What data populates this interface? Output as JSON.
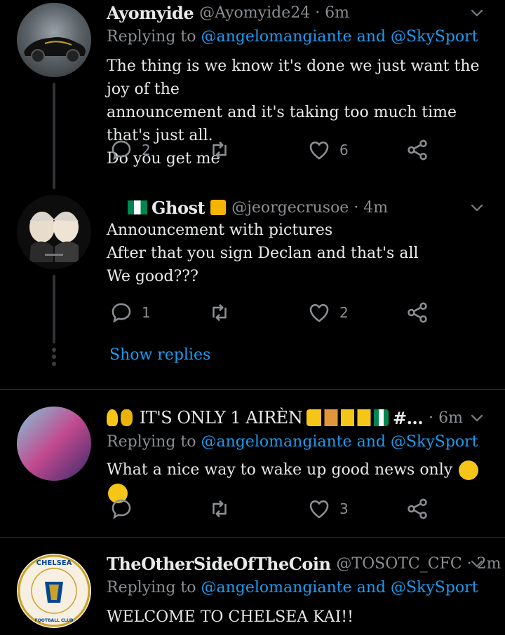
{
  "tweets": [
    {
      "name": "Ayomyide",
      "handle": "@Ayomyide24 · 6m",
      "replying_prefix": "Replying to",
      "replying_to": "@angelomangiante and @SkySport",
      "lines": [
        "The thing is we know it's done we just want the joy of the",
        "announcement and it's taking too much time that's just all.",
        "Do you get me"
      ],
      "replies": "2",
      "likes": "6"
    },
    {
      "name": "Ghost",
      "handle": "@jeorgecrusoe · 4m",
      "lines": [
        "Announcement with pictures",
        "After that you sign Declan and that's all",
        "We good???"
      ],
      "replies": "1",
      "likes": "2",
      "show_replies": "Show replies"
    },
    {
      "name": "IT'S ONLY 1 AIRÈN",
      "name_suffix": "#...",
      "handle": "· 6m",
      "replying_prefix": "Replying to",
      "replying_to": "@angelomangiante and @SkySport",
      "lines": [
        "What a nice way to wake up good news only"
      ],
      "replies": "",
      "likes": "3"
    },
    {
      "name": "TheOtherSideOfTheCoin",
      "handle": "@TOSOTC_CFC · 2m",
      "replying_prefix": "Replying to",
      "replying_to": "@angelomangiante and @SkySport",
      "lines": [
        "WELCOME TO CHELSEA KAI!!"
      ],
      "avatar_text_top": "CHELSEA",
      "avatar_text_bottom": "FOOTBALL CLUB"
    }
  ],
  "icons": [
    "reply-icon",
    "retweet-icon",
    "like-icon",
    "share-icon",
    "chevron-down-icon"
  ],
  "colors": {
    "background": "#000000",
    "link": "#1d9bf0",
    "muted": "#8b8f93",
    "text": "#e7e9ea"
  }
}
